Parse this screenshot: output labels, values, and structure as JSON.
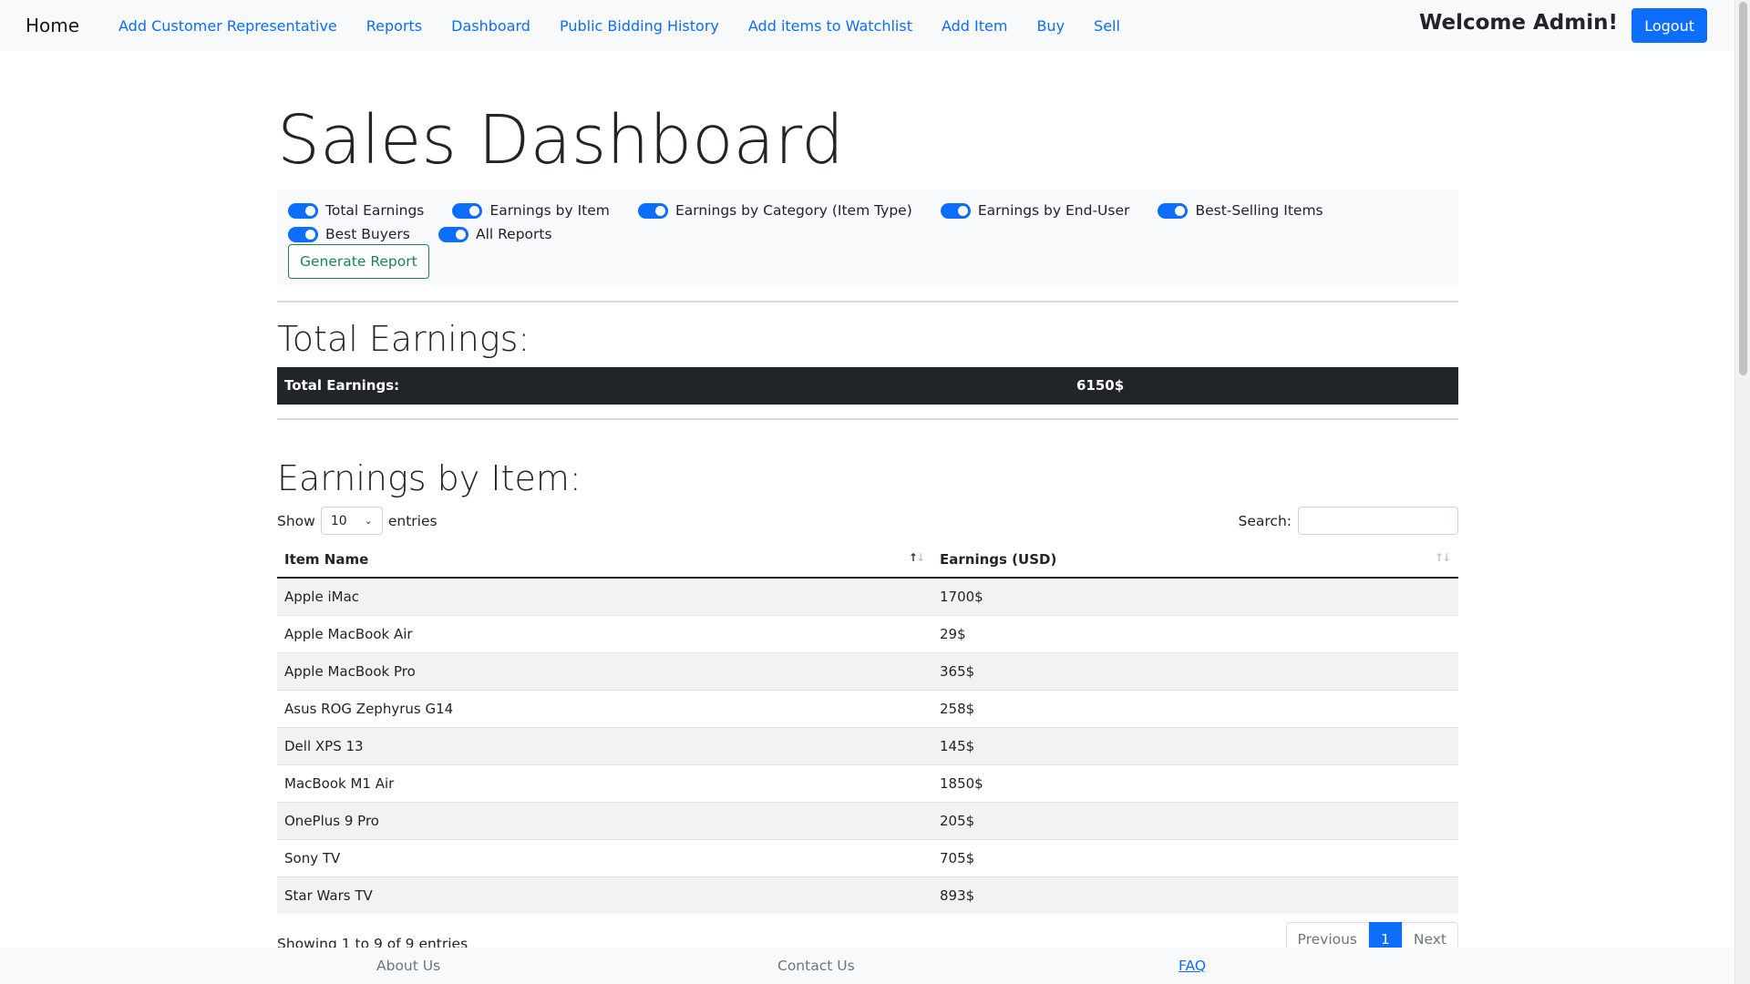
{
  "navbar": {
    "brand": "Home",
    "links": [
      "Add Customer Representative",
      "Reports",
      "Dashboard",
      "Public Bidding History",
      "Add items to Watchlist",
      "Add Item",
      "Buy",
      "Sell"
    ],
    "welcome": "Welcome Admin!",
    "logout_label": "Logout"
  },
  "page": {
    "title": "Sales Dashboard"
  },
  "report_options": {
    "switches": [
      {
        "label": "Total Earnings",
        "checked": true
      },
      {
        "label": "Earnings by Item",
        "checked": true
      },
      {
        "label": "Earnings by Category (Item Type)",
        "checked": true
      },
      {
        "label": "Earnings by End-User",
        "checked": true
      },
      {
        "label": "Best-Selling Items",
        "checked": true
      },
      {
        "label": "Best Buyers",
        "checked": true
      },
      {
        "label": "All Reports",
        "checked": true
      }
    ],
    "generate_label": "Generate Report"
  },
  "total_earnings": {
    "heading": "Total Earnings:",
    "row_label": "Total Earnings:",
    "value": "6150$"
  },
  "earnings_by_item": {
    "heading": "Earnings by Item:",
    "show_label": "Show",
    "entries_value": "10",
    "entries_label": "entries",
    "search_label": "Search:",
    "search_value": "",
    "columns": [
      "Item Name",
      "Earnings (USD)"
    ],
    "rows": [
      [
        "Apple iMac",
        "1700$"
      ],
      [
        "Apple MacBook Air",
        "29$"
      ],
      [
        "Apple MacBook Pro",
        "365$"
      ],
      [
        "Asus ROG Zephyrus G14",
        "258$"
      ],
      [
        "Dell XPS 13",
        "145$"
      ],
      [
        "MacBook M1 Air",
        "1850$"
      ],
      [
        "OnePlus 9 Pro",
        "205$"
      ],
      [
        "Sony TV",
        "705$"
      ],
      [
        "Star Wars TV",
        "893$"
      ]
    ],
    "info": "Showing 1 to 9 of 9 entries",
    "pagination": {
      "previous": "Previous",
      "current": "1",
      "next": "Next"
    }
  },
  "footer": {
    "links": [
      "About Us",
      "Contact Us",
      "FAQ"
    ]
  },
  "colors": {
    "primary": "#0d6efd",
    "success": "#198754",
    "dark": "#212529",
    "light": "#f8f9fa"
  }
}
